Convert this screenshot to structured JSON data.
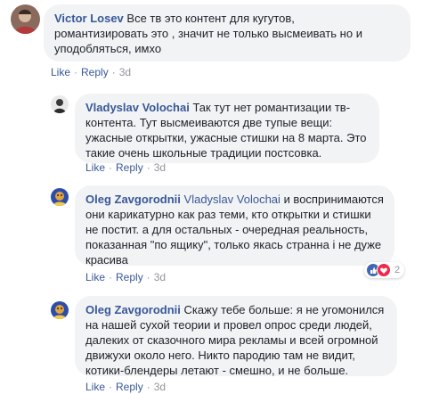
{
  "comments": [
    {
      "author": "Victor Losev",
      "lines": [
        "Все тв это контент для кугутов,",
        "романтизировать это , значит не только высмеивать но и",
        "уподобляться, имхо"
      ],
      "actions": {
        "like": "Like",
        "reply": "Reply",
        "time": "3d"
      }
    },
    {
      "author": "Vladyslav Volochai",
      "lines": [
        "Так тут нет романтизации тв-",
        "контента. Тут высмеиваются две тупые вещи:",
        "ужасные открытки, ужасные стишки на 8 марта. Это",
        "такие очень школьные традиции постсовка."
      ],
      "actions": {
        "like": "Like",
        "reply": "Reply",
        "time": "3d"
      }
    },
    {
      "author": "Oleg Zavgorodnii",
      "mention": "Vladyslav Volochai",
      "lines": [
        "и воспринимаются",
        "они карикатурно как раз теми, кто открытки и стишки",
        "не постит. а для остальных - очередная реальность,",
        "показанная \"по ящику\", только якась странна і не дуже",
        "красива"
      ],
      "reactions": {
        "count": "2"
      },
      "actions": {
        "like": "Like",
        "reply": "Reply",
        "time": "3d"
      }
    },
    {
      "author": "Oleg Zavgorodnii",
      "lines": [
        "Скажу тебе больше: я не угомонился",
        "на нашей сухой теории и провел опрос среди людей,",
        "далеких от сказочного мира рекламы и всей огромной",
        "движухи около него. Никто пародию там не видит,",
        "котики-блендеры летают - смешно, и не больше."
      ],
      "actions": {
        "like": "Like",
        "reply": "Reply",
        "time": "3d"
      }
    }
  ],
  "colors": {
    "link": "#385898",
    "bubble": "#f2f3f5",
    "meta": "#90949c"
  }
}
